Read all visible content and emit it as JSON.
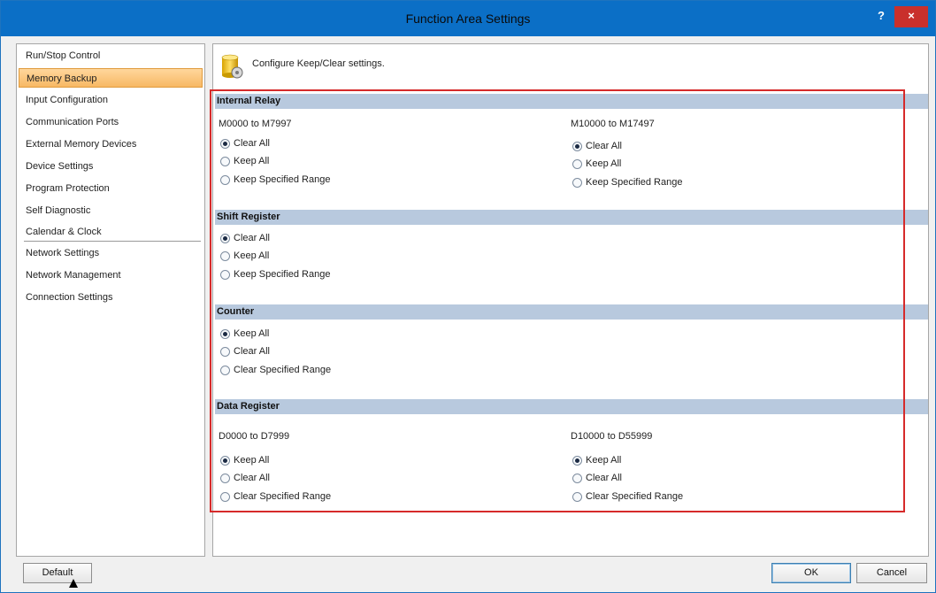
{
  "window": {
    "title": "Function Area Settings",
    "help_label": "?",
    "close_label": "×"
  },
  "nav": {
    "items": [
      {
        "label": "Run/Stop Control",
        "active": false
      },
      {
        "label": "Memory Backup",
        "active": true
      },
      {
        "label": "Input Configuration",
        "active": false
      },
      {
        "label": "Communication Ports",
        "active": false
      },
      {
        "label": "External Memory Devices",
        "active": false
      },
      {
        "label": "Device Settings",
        "active": false
      },
      {
        "label": "Program Protection",
        "active": false
      },
      {
        "label": "Self Diagnostic",
        "active": false
      },
      {
        "label": "Calendar & Clock",
        "active": false
      },
      {
        "label": "Network Settings",
        "active": false
      },
      {
        "label": "Network Management",
        "active": false
      },
      {
        "label": "Connection Settings",
        "active": false
      }
    ]
  },
  "main": {
    "description": "Configure Keep/Clear settings.",
    "icon": "database-icon",
    "internal_relay": {
      "header": "Internal Relay",
      "left": {
        "range": "M0000 to M7997",
        "options": [
          "Clear All",
          "Keep All",
          "Keep Specified Range"
        ],
        "selected": "Clear All"
      },
      "right": {
        "range": "M10000 to M17497",
        "options": [
          "Clear All",
          "Keep All",
          "Keep Specified Range"
        ],
        "selected": "Clear All"
      }
    },
    "shift_register": {
      "header": "Shift Register",
      "options": [
        "Clear All",
        "Keep All",
        "Keep Specified Range"
      ],
      "selected": "Clear All"
    },
    "counter": {
      "header": "Counter",
      "options": [
        "Keep All",
        "Clear All",
        "Clear Specified Range"
      ],
      "selected": "Keep All"
    },
    "data_register": {
      "header": "Data Register",
      "left": {
        "range": "D0000 to D7999",
        "options": [
          "Keep All",
          "Clear All",
          "Clear Specified Range"
        ],
        "selected": "Keep All"
      },
      "right": {
        "range": "D10000 to D55999",
        "options": [
          "Keep All",
          "Clear All",
          "Clear Specified Range"
        ],
        "selected": "Keep All"
      }
    }
  },
  "buttons": {
    "default_label": "Default",
    "ok_label": "OK",
    "cancel_label": "Cancel"
  },
  "colors": {
    "title_bar": "#0b6fc6",
    "close_button": "#c9302c",
    "section_header": "#b8c9de",
    "highlight_frame": "#d62a2a",
    "active_nav": "#f7b864"
  }
}
